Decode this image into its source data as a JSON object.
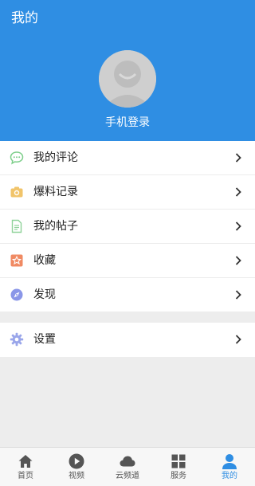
{
  "header": {
    "title": "我的",
    "login_label": "手机登录",
    "background_color": "#2f8ee3"
  },
  "menu": {
    "items": [
      {
        "label": "我的评论",
        "icon": "comment-bubble-icon",
        "color": "#7dce8a"
      },
      {
        "label": "爆料记录",
        "icon": "camera-icon",
        "color": "#f1c46a"
      },
      {
        "label": "我的帖子",
        "icon": "document-icon",
        "color": "#8fd29a"
      },
      {
        "label": "收藏",
        "icon": "star-icon",
        "color": "#f08a63"
      },
      {
        "label": "发现",
        "icon": "compass-icon",
        "color": "#8a96e8"
      }
    ],
    "settings": {
      "label": "设置",
      "icon": "gear-icon",
      "color": "#9aa6ea"
    }
  },
  "tabbar": {
    "active_color": "#2f8ee3",
    "tabs": [
      {
        "label": "首页",
        "icon": "home-icon"
      },
      {
        "label": "视频",
        "icon": "play-icon"
      },
      {
        "label": "云频道",
        "icon": "cloud-icon"
      },
      {
        "label": "服务",
        "icon": "grid-icon"
      },
      {
        "label": "我的",
        "icon": "person-icon",
        "active": true
      }
    ]
  }
}
